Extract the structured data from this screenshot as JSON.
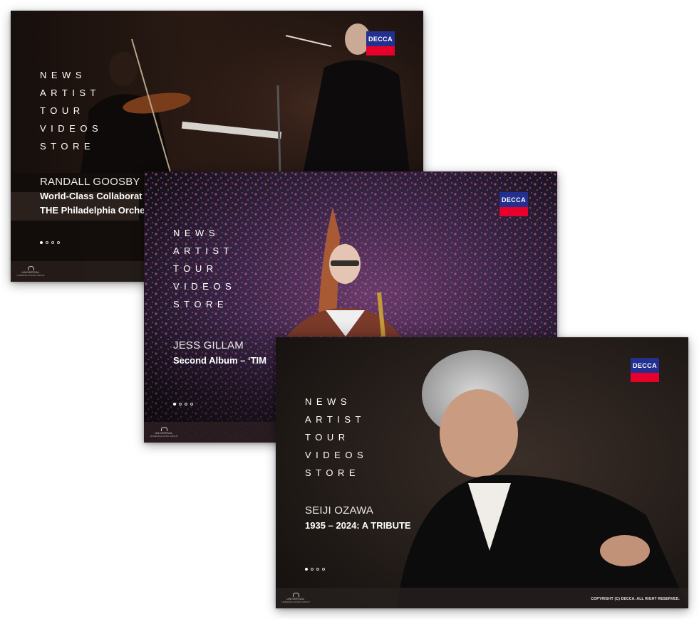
{
  "brand": {
    "logo_text": "DECCA",
    "logo_blue": "#24308f",
    "logo_red": "#e6002b"
  },
  "label_logo": {
    "name": "UNIVERSAL",
    "sub": "UNIVERSAL MUSIC GROUP"
  },
  "nav": [
    "NEWS",
    "ARTIST",
    "TOUR",
    "VIDEOS",
    "STORE"
  ],
  "slides": [
    {
      "artist": "RANDALL GOOSBY",
      "headline_line1": "World-Class Collaborat",
      "headline_line2": "THE Philadelphia Orche",
      "dots_active": 1,
      "dots_total": 4
    },
    {
      "artist": "JESS GILLAM",
      "headline_line1": "Second Album – ‘TIM",
      "dots_active": 1,
      "dots_total": 4
    },
    {
      "artist": "SEIJI OZAWA",
      "headline_line1": "1935 – 2024: A TRIBUTE",
      "dots_active": 1,
      "dots_total": 4,
      "copyright": "COPYRIGHT (C) DECCA. ALL RIGHT RESERVED."
    }
  ]
}
